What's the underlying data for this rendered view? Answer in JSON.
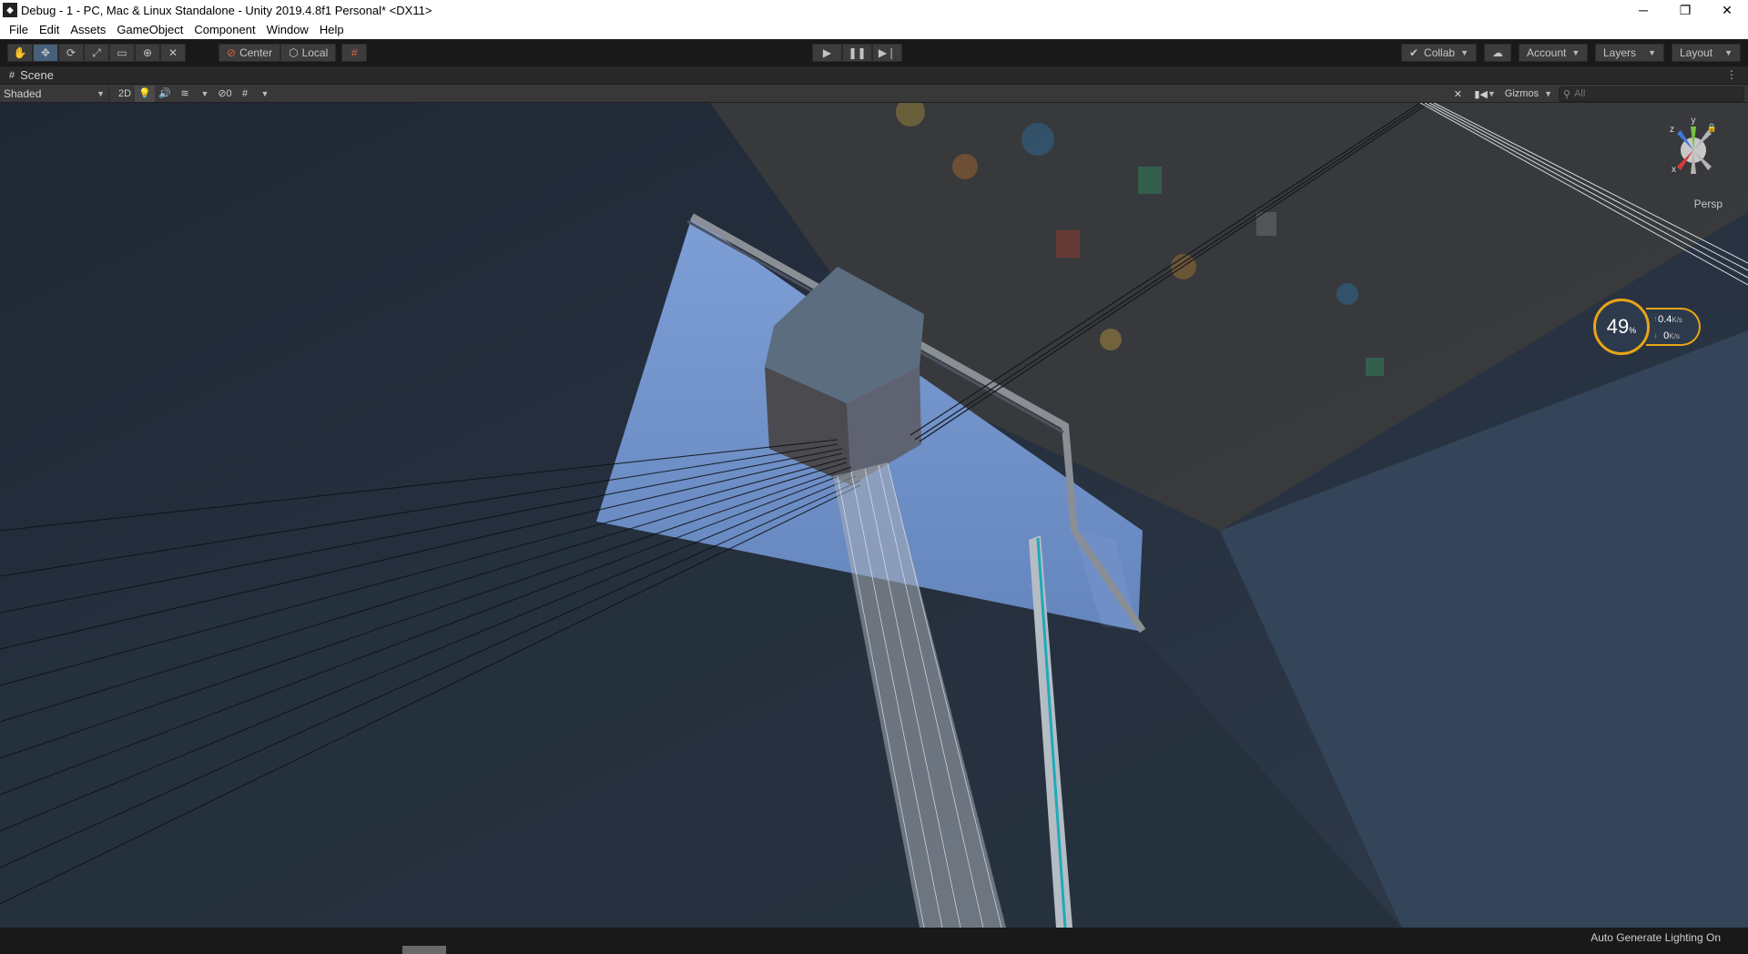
{
  "window": {
    "title": "Debug - 1 - PC, Mac & Linux Standalone - Unity 2019.4.8f1 Personal* <DX11>",
    "controls": [
      "─",
      "❐",
      "✕"
    ]
  },
  "menu": [
    "File",
    "Edit",
    "Assets",
    "GameObject",
    "Component",
    "Window",
    "Help"
  ],
  "toolbar": {
    "tools": [
      "hand-tool",
      "move-tool",
      "rotate-tool",
      "scale-tool",
      "rect-tool",
      "transform-tool",
      "custom-tool"
    ],
    "active_tool": "move-tool",
    "pivot_mode": "Center",
    "pivot_rotation": "Local",
    "collab": "Collab",
    "account": "Account",
    "layers": "Layers",
    "layout": "Layout"
  },
  "scene": {
    "tab_label": "Scene",
    "draw_mode": "Shaded",
    "mode_2d": "2D",
    "hidden_count": "0",
    "gizmos": "Gizmos",
    "search_placeholder": "All",
    "projection": "Persp",
    "gizmo_axes": {
      "x": "x",
      "y": "y",
      "z": "z"
    }
  },
  "net_monitor": {
    "percent": "49",
    "percent_unit": "%",
    "up_value": "0.4",
    "up_unit": "K/s",
    "down_value": "0",
    "down_unit": "K/s",
    "accent": "#e8a417"
  },
  "status": {
    "lighting": "Auto Generate Lighting On"
  },
  "colors": {
    "editor_bg": "#191919",
    "scene_bg": "#2a3442",
    "sky": "#6b8fc9",
    "active_tool": "#46607c"
  }
}
